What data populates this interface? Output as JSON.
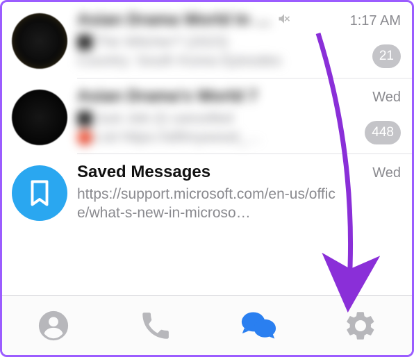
{
  "chats": [
    {
      "title": "Asian Drama World In …",
      "timestamp": "1:17 AM",
      "badge": "21",
      "muted": true,
      "snippet_line1": "The   Witcher? (2023)",
      "snippet_line2": "Country: South Korea  Episodes"
    },
    {
      "title": "Asian Drama's World 7",
      "timestamp": "Wed",
      "badge": "448",
      "muted": false,
      "snippet_line1": "Just Job (I)  cancelled",
      "snippet_line2": "List   https://afilmywood_…"
    },
    {
      "title": "Saved Messages",
      "timestamp": "Wed",
      "snippet": "https://support.microsoft.com/en-us/office/what-s-new-in-microso…"
    }
  ],
  "tabs": {
    "contacts": "contacts",
    "calls": "calls",
    "chats": "chats",
    "settings": "settings"
  }
}
